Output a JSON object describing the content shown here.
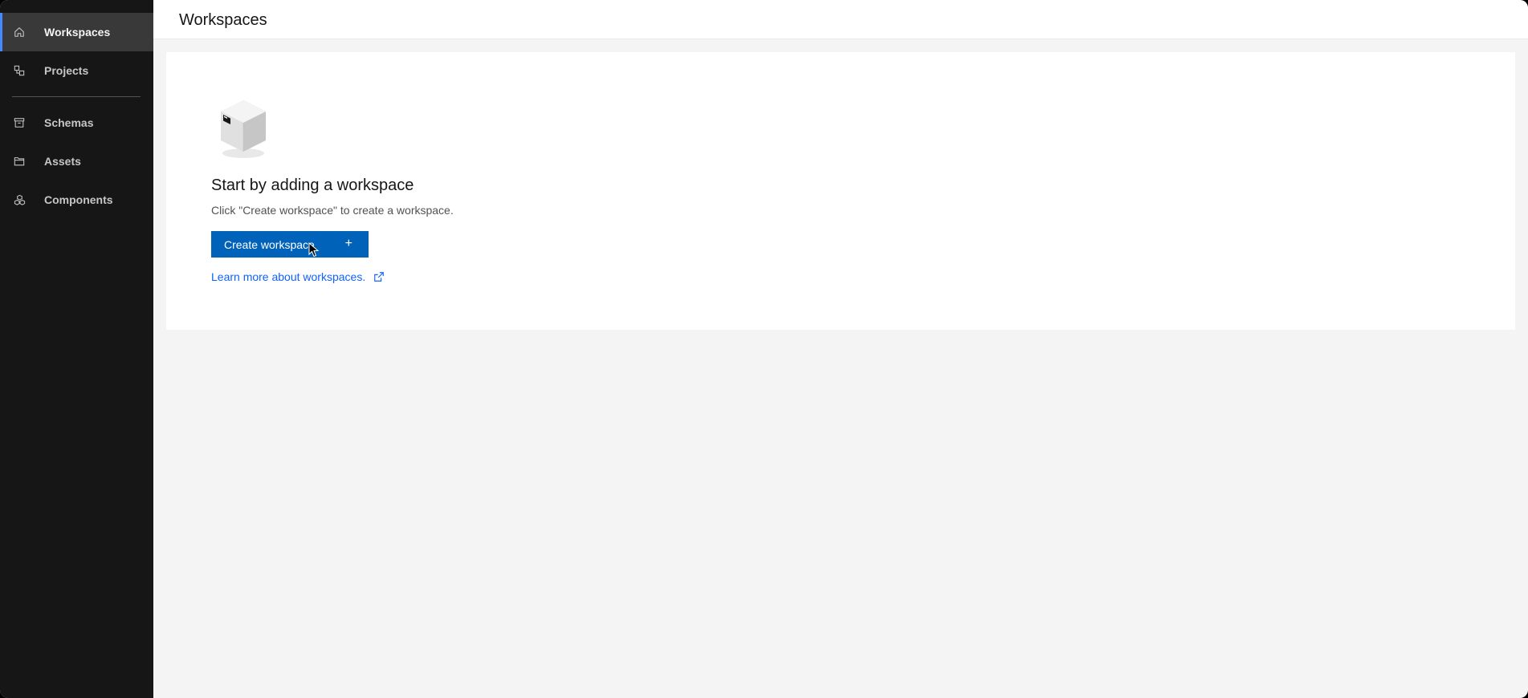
{
  "sidebar": {
    "items": [
      {
        "label": "Workspaces",
        "icon": "home-icon",
        "active": true
      },
      {
        "label": "Projects",
        "icon": "projects-icon",
        "active": false
      },
      {
        "label": "Schemas",
        "icon": "archive-icon",
        "active": false
      },
      {
        "label": "Assets",
        "icon": "folder-icon",
        "active": false
      },
      {
        "label": "Components",
        "icon": "components-icon",
        "active": false
      }
    ]
  },
  "header": {
    "title": "Workspaces"
  },
  "empty_state": {
    "pictogram": "box-pictogram-icon",
    "title": "Start by adding a workspace",
    "body": "Click \"Create workspace\" to create a workspace.",
    "create_button": "Create workspace",
    "create_button_icon": "+",
    "learn_more": "Learn more about workspaces."
  },
  "colors": {
    "sidebar_bg": "#161616",
    "active_indicator": "#4589ff",
    "primary_button": "#0062b8",
    "link": "#0f62fe"
  }
}
